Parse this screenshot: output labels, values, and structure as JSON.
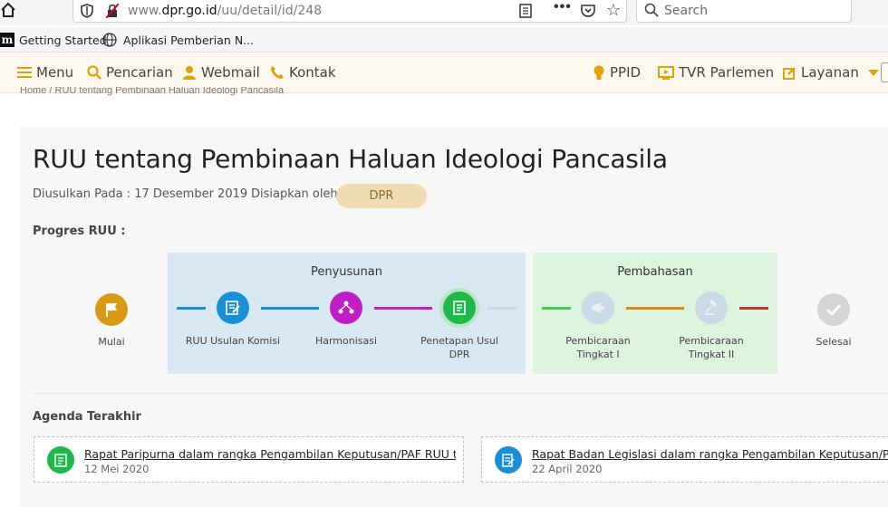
{
  "browser": {
    "url_prefix": "www.",
    "url_domain": "dpr.go.id",
    "url_path": "/uu/detail/id/248",
    "search_placeholder": "Search",
    "overflow_label": "•••",
    "bookmarks": [
      {
        "label": "Getting Started",
        "icon": "m-logo"
      },
      {
        "label": "Aplikasi Pemberian N...",
        "icon": "globe-icon"
      }
    ]
  },
  "nav": {
    "menu": "Menu",
    "pencarian": "Pencarian",
    "webmail": "Webmail",
    "kontak": "Kontak",
    "ppid": "PPID",
    "tvr": "TVR Parlemen",
    "layanan": "Layanan"
  },
  "breadcrumb": "Home / RUU tentang Pembinaan Haluan Ideologi Pancasila",
  "detail": {
    "title": "RUU tentang Pembinaan Haluan Ideologi Pancasila",
    "diusulkan": "Diusulkan Pada : 17 Desember 2019",
    "disiapkan_label": "Disiapkan oleh :",
    "disiapkan_value": "DPR",
    "progres_label": "Progres RUU :"
  },
  "progress": {
    "stage_penyusunan": "Penyusunan",
    "stage_pembahasan": "Pembahasan",
    "steps": {
      "mulai": "Mulai",
      "usulan": "RUU Usulan Komisi",
      "harmonisasi": "Harmonisasi",
      "penetapan_1": "Penetapan Usul",
      "penetapan_2": "DPR",
      "tk1_1": "Pembicaraan",
      "tk1_2": "Tingkat I",
      "tk2_1": "Pembicaraan",
      "tk2_2": "Tingkat II",
      "selesai": "Selesai"
    },
    "colors": {
      "mulai": "#d99a13",
      "usulan": "#1a8fd6",
      "harmonisasi": "#c21ec7",
      "penetapan": "#1fb84a",
      "inactive": "#c9dbe6",
      "selesai": "#d5d5d5"
    }
  },
  "agenda": {
    "label": "Agenda Terakhir",
    "items": [
      {
        "title": "Rapat Paripurna dalam rangka Pengambilan Keputusan/PAF RUU ten...",
        "date": "12 Mei 2020",
        "color": "#1fb84a"
      },
      {
        "title": "Rapat Badan Legislasi dalam rangka Pengambilan Keputusan/PAF atas",
        "date": "22 April 2020",
        "color": "#1a8fd6"
      }
    ]
  }
}
